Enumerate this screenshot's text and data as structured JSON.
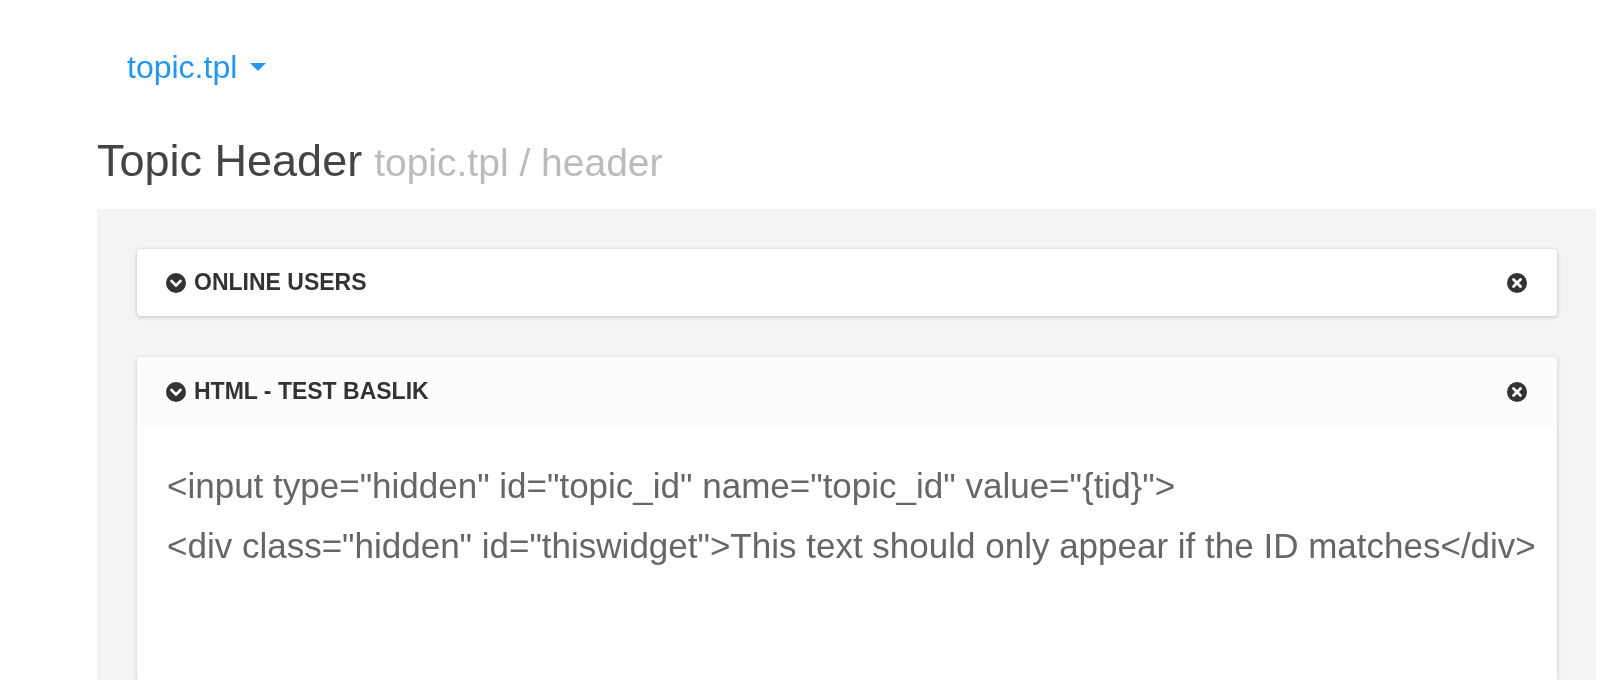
{
  "template_selector": {
    "label": "topic.tpl"
  },
  "heading": {
    "title": "Topic Header",
    "subtitle": "topic.tpl / header"
  },
  "widgets": [
    {
      "title": "ONLINE USERS",
      "expanded": false
    },
    {
      "title": "HTML - TEST BASLIK",
      "expanded": true,
      "content_lines": [
        "<input type=\"hidden\" id=\"topic_id\" name=\"topic_id\" value=\"{tid}\">",
        "<div class=\"hidden\" id=\"thiswidget\">This text should only appear if the ID matches</div>"
      ]
    }
  ]
}
